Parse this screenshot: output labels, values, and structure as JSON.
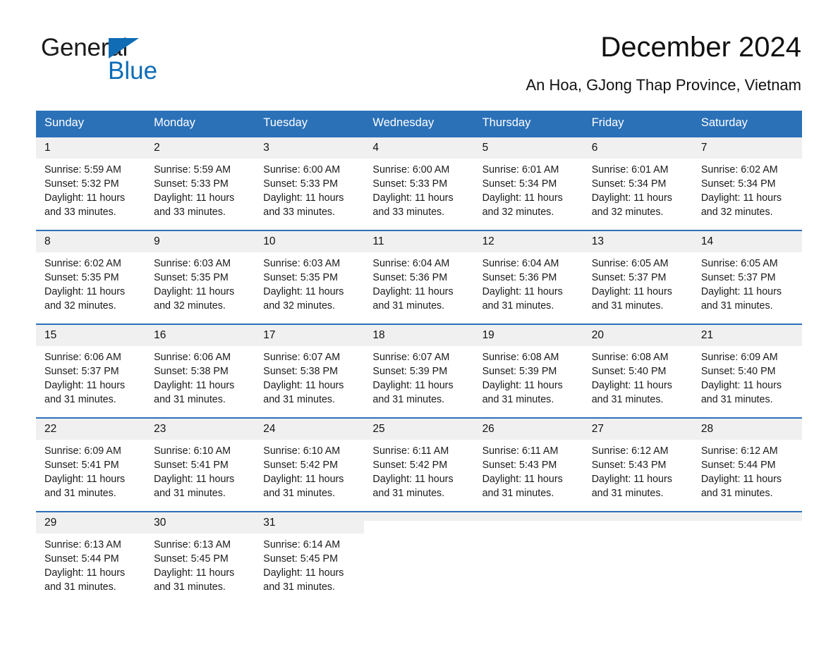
{
  "brand": {
    "name_part1": "General",
    "name_part2": "Blue",
    "accent_color": "#0f6cb5"
  },
  "header": {
    "title": "December 2024",
    "subtitle": "An Hoa, GJong Thap Province, Vietnam",
    "header_bg_color": "#2b71b8"
  },
  "calendar": {
    "weekday_headers": [
      "Sunday",
      "Monday",
      "Tuesday",
      "Wednesday",
      "Thursday",
      "Friday",
      "Saturday"
    ],
    "weeks": [
      [
        {
          "day": "1",
          "sunrise": "Sunrise: 5:59 AM",
          "sunset": "Sunset: 5:32 PM",
          "daylight_line1": "Daylight: 11 hours",
          "daylight_line2": "and 33 minutes."
        },
        {
          "day": "2",
          "sunrise": "Sunrise: 5:59 AM",
          "sunset": "Sunset: 5:33 PM",
          "daylight_line1": "Daylight: 11 hours",
          "daylight_line2": "and 33 minutes."
        },
        {
          "day": "3",
          "sunrise": "Sunrise: 6:00 AM",
          "sunset": "Sunset: 5:33 PM",
          "daylight_line1": "Daylight: 11 hours",
          "daylight_line2": "and 33 minutes."
        },
        {
          "day": "4",
          "sunrise": "Sunrise: 6:00 AM",
          "sunset": "Sunset: 5:33 PM",
          "daylight_line1": "Daylight: 11 hours",
          "daylight_line2": "and 33 minutes."
        },
        {
          "day": "5",
          "sunrise": "Sunrise: 6:01 AM",
          "sunset": "Sunset: 5:34 PM",
          "daylight_line1": "Daylight: 11 hours",
          "daylight_line2": "and 32 minutes."
        },
        {
          "day": "6",
          "sunrise": "Sunrise: 6:01 AM",
          "sunset": "Sunset: 5:34 PM",
          "daylight_line1": "Daylight: 11 hours",
          "daylight_line2": "and 32 minutes."
        },
        {
          "day": "7",
          "sunrise": "Sunrise: 6:02 AM",
          "sunset": "Sunset: 5:34 PM",
          "daylight_line1": "Daylight: 11 hours",
          "daylight_line2": "and 32 minutes."
        }
      ],
      [
        {
          "day": "8",
          "sunrise": "Sunrise: 6:02 AM",
          "sunset": "Sunset: 5:35 PM",
          "daylight_line1": "Daylight: 11 hours",
          "daylight_line2": "and 32 minutes."
        },
        {
          "day": "9",
          "sunrise": "Sunrise: 6:03 AM",
          "sunset": "Sunset: 5:35 PM",
          "daylight_line1": "Daylight: 11 hours",
          "daylight_line2": "and 32 minutes."
        },
        {
          "day": "10",
          "sunrise": "Sunrise: 6:03 AM",
          "sunset": "Sunset: 5:35 PM",
          "daylight_line1": "Daylight: 11 hours",
          "daylight_line2": "and 32 minutes."
        },
        {
          "day": "11",
          "sunrise": "Sunrise: 6:04 AM",
          "sunset": "Sunset: 5:36 PM",
          "daylight_line1": "Daylight: 11 hours",
          "daylight_line2": "and 31 minutes."
        },
        {
          "day": "12",
          "sunrise": "Sunrise: 6:04 AM",
          "sunset": "Sunset: 5:36 PM",
          "daylight_line1": "Daylight: 11 hours",
          "daylight_line2": "and 31 minutes."
        },
        {
          "day": "13",
          "sunrise": "Sunrise: 6:05 AM",
          "sunset": "Sunset: 5:37 PM",
          "daylight_line1": "Daylight: 11 hours",
          "daylight_line2": "and 31 minutes."
        },
        {
          "day": "14",
          "sunrise": "Sunrise: 6:05 AM",
          "sunset": "Sunset: 5:37 PM",
          "daylight_line1": "Daylight: 11 hours",
          "daylight_line2": "and 31 minutes."
        }
      ],
      [
        {
          "day": "15",
          "sunrise": "Sunrise: 6:06 AM",
          "sunset": "Sunset: 5:37 PM",
          "daylight_line1": "Daylight: 11 hours",
          "daylight_line2": "and 31 minutes."
        },
        {
          "day": "16",
          "sunrise": "Sunrise: 6:06 AM",
          "sunset": "Sunset: 5:38 PM",
          "daylight_line1": "Daylight: 11 hours",
          "daylight_line2": "and 31 minutes."
        },
        {
          "day": "17",
          "sunrise": "Sunrise: 6:07 AM",
          "sunset": "Sunset: 5:38 PM",
          "daylight_line1": "Daylight: 11 hours",
          "daylight_line2": "and 31 minutes."
        },
        {
          "day": "18",
          "sunrise": "Sunrise: 6:07 AM",
          "sunset": "Sunset: 5:39 PM",
          "daylight_line1": "Daylight: 11 hours",
          "daylight_line2": "and 31 minutes."
        },
        {
          "day": "19",
          "sunrise": "Sunrise: 6:08 AM",
          "sunset": "Sunset: 5:39 PM",
          "daylight_line1": "Daylight: 11 hours",
          "daylight_line2": "and 31 minutes."
        },
        {
          "day": "20",
          "sunrise": "Sunrise: 6:08 AM",
          "sunset": "Sunset: 5:40 PM",
          "daylight_line1": "Daylight: 11 hours",
          "daylight_line2": "and 31 minutes."
        },
        {
          "day": "21",
          "sunrise": "Sunrise: 6:09 AM",
          "sunset": "Sunset: 5:40 PM",
          "daylight_line1": "Daylight: 11 hours",
          "daylight_line2": "and 31 minutes."
        }
      ],
      [
        {
          "day": "22",
          "sunrise": "Sunrise: 6:09 AM",
          "sunset": "Sunset: 5:41 PM",
          "daylight_line1": "Daylight: 11 hours",
          "daylight_line2": "and 31 minutes."
        },
        {
          "day": "23",
          "sunrise": "Sunrise: 6:10 AM",
          "sunset": "Sunset: 5:41 PM",
          "daylight_line1": "Daylight: 11 hours",
          "daylight_line2": "and 31 minutes."
        },
        {
          "day": "24",
          "sunrise": "Sunrise: 6:10 AM",
          "sunset": "Sunset: 5:42 PM",
          "daylight_line1": "Daylight: 11 hours",
          "daylight_line2": "and 31 minutes."
        },
        {
          "day": "25",
          "sunrise": "Sunrise: 6:11 AM",
          "sunset": "Sunset: 5:42 PM",
          "daylight_line1": "Daylight: 11 hours",
          "daylight_line2": "and 31 minutes."
        },
        {
          "day": "26",
          "sunrise": "Sunrise: 6:11 AM",
          "sunset": "Sunset: 5:43 PM",
          "daylight_line1": "Daylight: 11 hours",
          "daylight_line2": "and 31 minutes."
        },
        {
          "day": "27",
          "sunrise": "Sunrise: 6:12 AM",
          "sunset": "Sunset: 5:43 PM",
          "daylight_line1": "Daylight: 11 hours",
          "daylight_line2": "and 31 minutes."
        },
        {
          "day": "28",
          "sunrise": "Sunrise: 6:12 AM",
          "sunset": "Sunset: 5:44 PM",
          "daylight_line1": "Daylight: 11 hours",
          "daylight_line2": "and 31 minutes."
        }
      ],
      [
        {
          "day": "29",
          "sunrise": "Sunrise: 6:13 AM",
          "sunset": "Sunset: 5:44 PM",
          "daylight_line1": "Daylight: 11 hours",
          "daylight_line2": "and 31 minutes."
        },
        {
          "day": "30",
          "sunrise": "Sunrise: 6:13 AM",
          "sunset": "Sunset: 5:45 PM",
          "daylight_line1": "Daylight: 11 hours",
          "daylight_line2": "and 31 minutes."
        },
        {
          "day": "31",
          "sunrise": "Sunrise: 6:14 AM",
          "sunset": "Sunset: 5:45 PM",
          "daylight_line1": "Daylight: 11 hours",
          "daylight_line2": "and 31 minutes."
        },
        {
          "day": "",
          "sunrise": "",
          "sunset": "",
          "daylight_line1": "",
          "daylight_line2": ""
        },
        {
          "day": "",
          "sunrise": "",
          "sunset": "",
          "daylight_line1": "",
          "daylight_line2": ""
        },
        {
          "day": "",
          "sunrise": "",
          "sunset": "",
          "daylight_line1": "",
          "daylight_line2": ""
        },
        {
          "day": "",
          "sunrise": "",
          "sunset": "",
          "daylight_line1": "",
          "daylight_line2": ""
        }
      ]
    ]
  }
}
